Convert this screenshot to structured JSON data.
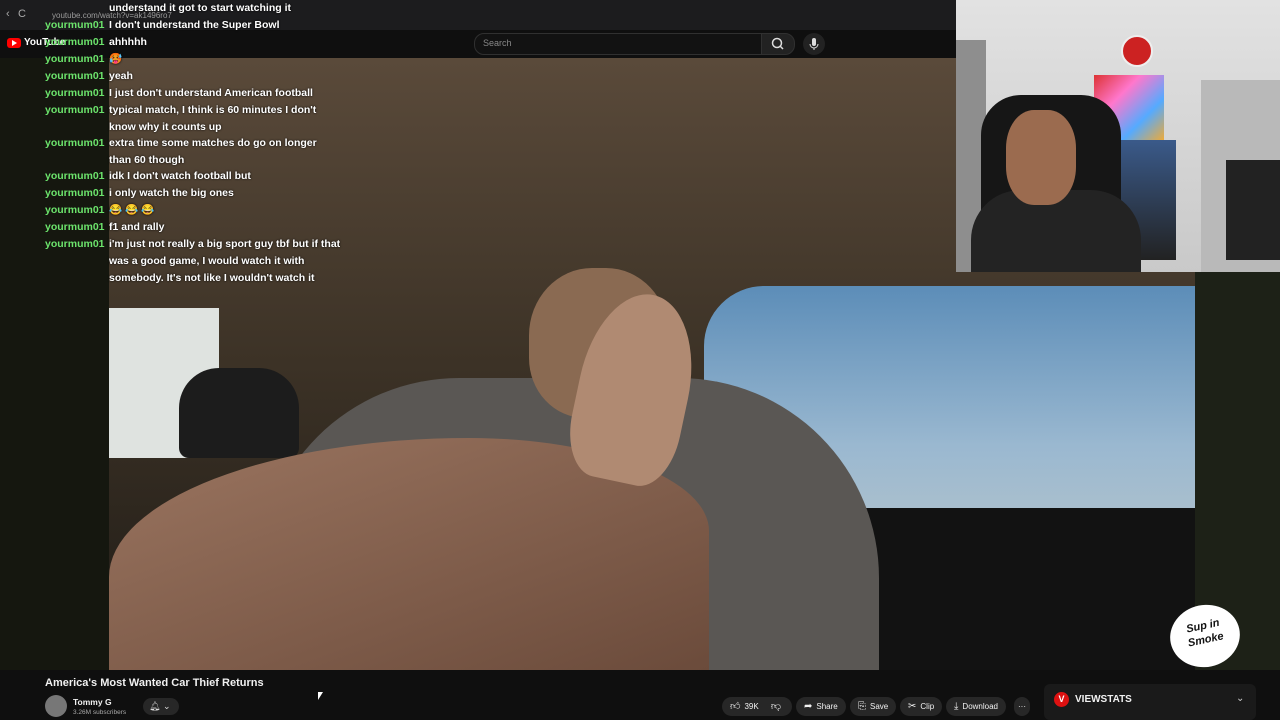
{
  "browser": {
    "url": "youtube.com/watch?v=ak1496ro7",
    "back": "‹",
    "reload": "C"
  },
  "youtube": {
    "logo": "YouTube",
    "search_placeholder": "Search"
  },
  "chat": [
    {
      "user": "",
      "text": "understand it got to start watching it⁣"
    },
    {
      "user": "yourmum01",
      "text": "I don't understand the Super Bowl⁣"
    },
    {
      "user": "yourmum01",
      "text": "ahhhhh"
    },
    {
      "user": "yourmum01",
      "text": "🥵"
    },
    {
      "user": "yourmum01",
      "text": "yeah"
    },
    {
      "user": "yourmum01",
      "text": "I just don't understand American football"
    },
    {
      "user": "yourmum01",
      "text": "typical match, I think is 60 minutes I don't know why it counts up⁣"
    },
    {
      "user": "yourmum01",
      "text": "extra time some matches do go on longer than 60 though"
    },
    {
      "user": "yourmum01",
      "text": "idk I don't watch football but"
    },
    {
      "user": "yourmum01",
      "text": "i only watch the big ones"
    },
    {
      "user": "yourmum01",
      "text": "😂 😂 😂"
    },
    {
      "user": "yourmum01",
      "text": "f1 and rally"
    },
    {
      "user": "yourmum01",
      "text": "i'm just not really a big sport guy tbf but if that was a good game, I would watch it with somebody. It's not like I wouldn't watch it⁣"
    }
  ],
  "video": {
    "title": "America's Most Wanted Car Thief Returns"
  },
  "channel": {
    "name": "Tommy G",
    "subscribers": "3.26M subscribers"
  },
  "actions": {
    "likes": "39K",
    "share": "Share",
    "save": "Save",
    "clip": "Clip",
    "download": "Download",
    "more": "···"
  },
  "overlay_logo": "Sup in Smoke",
  "sidebar_widget": {
    "name": "VIEWSTATS",
    "icon": "V"
  },
  "icons": {
    "search": "search-icon",
    "mic": "mic-icon",
    "bell": "bell-icon",
    "like": "thumbs-up-icon",
    "dislike": "thumbs-down-icon"
  }
}
